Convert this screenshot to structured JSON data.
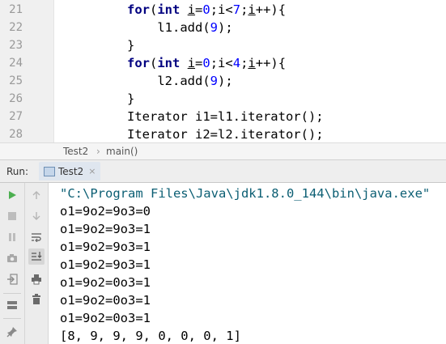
{
  "editor": {
    "line_numbers": [
      "21",
      "22",
      "23",
      "24",
      "25",
      "26",
      "27",
      "28"
    ],
    "lines": [
      {
        "kw": "for",
        "open": "(",
        "kw2": "int",
        "sp": " ",
        "v1": "i",
        "mid1": "=",
        "n1": "0",
        "mid2": ";i<",
        "n2": "7",
        "mid3": ";",
        "v2": "i",
        "end": "++){"
      },
      {
        "text": "    l1.add(",
        "num": "9",
        "end": ");"
      },
      {
        "text": "}"
      },
      {
        "kw": "for",
        "open": "(",
        "kw2": "int",
        "sp": " ",
        "v1": "i",
        "mid1": "=",
        "n1": "0",
        "mid2": ";i<",
        "n2": "4",
        "mid3": ";",
        "v2": "i",
        "end": "++){"
      },
      {
        "text": "    l2.add(",
        "num": "9",
        "end": ");"
      },
      {
        "text": "}"
      },
      {
        "text": "Iterator i1=l1.iterator();"
      },
      {
        "text": "Iterator i2=l2.iterator();"
      }
    ]
  },
  "breadcrumb": {
    "items": [
      "Test2",
      "main()"
    ],
    "separator": "›"
  },
  "run_panel": {
    "label": "Run:",
    "tab_label": "Test2",
    "tab_close": "×"
  },
  "console": {
    "lines": [
      "\"C:\\Program Files\\Java\\jdk1.8.0_144\\bin\\java.exe\"",
      "o1=9o2=9o3=0",
      "o1=9o2=9o3=1",
      "o1=9o2=9o3=1",
      "o1=9o2=9o3=1",
      "o1=9o2=0o3=1",
      "o1=9o2=0o3=1",
      "o1=9o2=0o3=1",
      "[8, 9, 9, 9, 0, 0, 0, 1]"
    ]
  },
  "toolbar_icons": {
    "left": [
      "run-icon",
      "stop-icon",
      "pause-icon",
      "camera-icon",
      "login-icon",
      "layout-icon",
      "pin-icon"
    ],
    "right": [
      "up-arrow-icon",
      "down-arrow-icon",
      "soft-wrap-icon",
      "scroll-to-end-icon",
      "print-icon",
      "trash-icon"
    ]
  },
  "colors": {
    "keyword": "#000080",
    "number": "#0000ff",
    "console_cmd": "#0b5e73",
    "run_green": "#4caf50"
  }
}
